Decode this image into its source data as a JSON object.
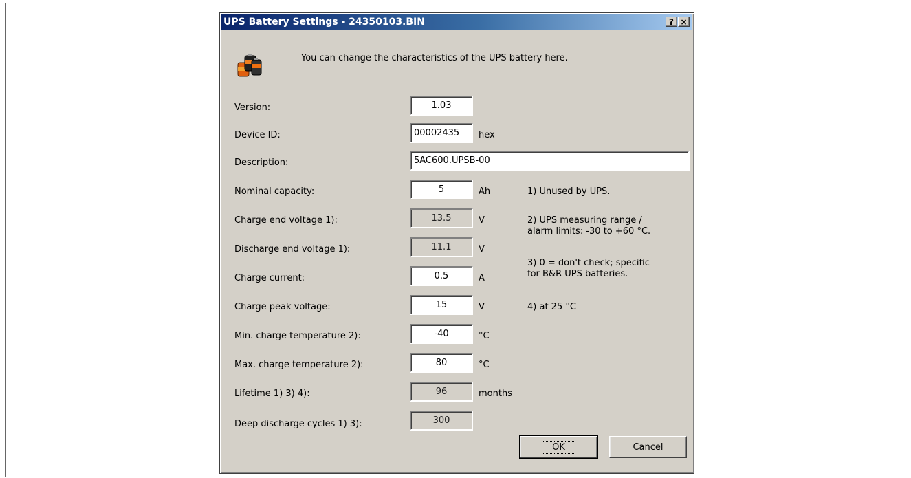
{
  "window": {
    "title": "UPS Battery Settings - 24350103.BIN",
    "help_label": "?",
    "close_label": "×"
  },
  "intro_text": "You can change the characteristics of the UPS battery here.",
  "fields": [
    {
      "label": "Version:",
      "value": "1.03",
      "unit": "",
      "editable": true
    },
    {
      "label": "Device ID:",
      "value": "00002435",
      "unit": "hex",
      "editable": true
    },
    {
      "label": "Description:",
      "value": "5AC600.UPSB-00",
      "unit": "",
      "editable": true
    },
    {
      "label": "Nominal capacity:",
      "value": "5",
      "unit": "Ah",
      "editable": true
    },
    {
      "label": "Charge end voltage 1):",
      "value": "13.5",
      "unit": "V",
      "editable": false
    },
    {
      "label": "Discharge end voltage 1):",
      "value": "11.1",
      "unit": "V",
      "editable": false
    },
    {
      "label": "Charge current:",
      "value": "0.5",
      "unit": "A",
      "editable": true
    },
    {
      "label": "Charge peak voltage:",
      "value": "15",
      "unit": "V",
      "editable": true
    },
    {
      "label": "Min. charge temperature 2):",
      "value": "-40",
      "unit": "°C",
      "editable": true
    },
    {
      "label": "Max. charge temperature 2):",
      "value": "80",
      "unit": "°C",
      "editable": true
    },
    {
      "label": "Lifetime 1) 3) 4):",
      "value": "96",
      "unit": "months",
      "editable": false
    },
    {
      "label": "Deep discharge cycles 1) 3):",
      "value": "300",
      "unit": "",
      "editable": false
    }
  ],
  "notes": {
    "n1": "1) Unused by UPS.",
    "n2_line1": "2) UPS measuring range /",
    "n2_line2": "alarm limits: -30 to +60 °C.",
    "n3_line1": "3) 0 = don't check; specific",
    "n3_line2": "for B&R UPS batteries.",
    "n4": "4) at 25 °C"
  },
  "buttons": {
    "ok": "OK",
    "cancel": "Cancel"
  }
}
